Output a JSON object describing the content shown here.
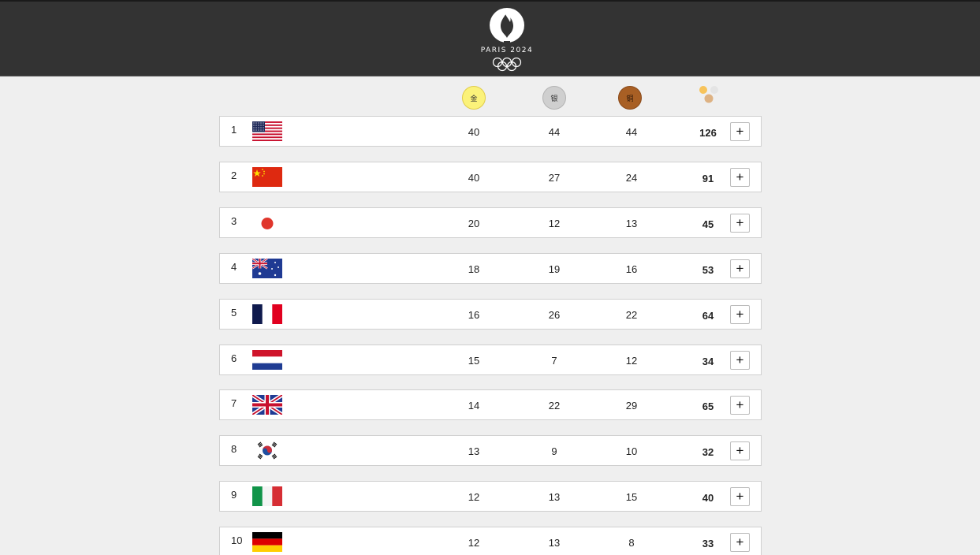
{
  "header": {
    "logo_text": "PARIS 2024"
  },
  "medal_headers": {
    "gold": "金",
    "silver": "银",
    "bronze": "铜"
  },
  "expand_label": "+",
  "rows": [
    {
      "rank": "1",
      "flag": "usa-flag-icon",
      "gold": "40",
      "silver": "44",
      "bronze": "44",
      "total": "126"
    },
    {
      "rank": "2",
      "flag": "china-flag-icon",
      "gold": "40",
      "silver": "27",
      "bronze": "24",
      "total": "91"
    },
    {
      "rank": "3",
      "flag": "japan-flag-icon",
      "gold": "20",
      "silver": "12",
      "bronze": "13",
      "total": "45"
    },
    {
      "rank": "4",
      "flag": "australia-flag-icon",
      "gold": "18",
      "silver": "19",
      "bronze": "16",
      "total": "53"
    },
    {
      "rank": "5",
      "flag": "france-flag-icon",
      "gold": "16",
      "silver": "26",
      "bronze": "22",
      "total": "64"
    },
    {
      "rank": "6",
      "flag": "netherlands-flag-icon",
      "gold": "15",
      "silver": "7",
      "bronze": "12",
      "total": "34"
    },
    {
      "rank": "7",
      "flag": "great-britain-flag-icon",
      "gold": "14",
      "silver": "22",
      "bronze": "29",
      "total": "65"
    },
    {
      "rank": "8",
      "flag": "south-korea-flag-icon",
      "gold": "13",
      "silver": "9",
      "bronze": "10",
      "total": "32"
    },
    {
      "rank": "9",
      "flag": "italy-flag-icon",
      "gold": "12",
      "silver": "13",
      "bronze": "15",
      "total": "40"
    },
    {
      "rank": "10",
      "flag": "germany-flag-icon",
      "gold": "12",
      "silver": "13",
      "bronze": "8",
      "total": "33"
    }
  ],
  "colors": {
    "header_bg": "#333333",
    "page_bg": "#efefef",
    "gold": "#fbf27a",
    "silver": "#cfcfcf",
    "bronze": "#a85f24"
  }
}
